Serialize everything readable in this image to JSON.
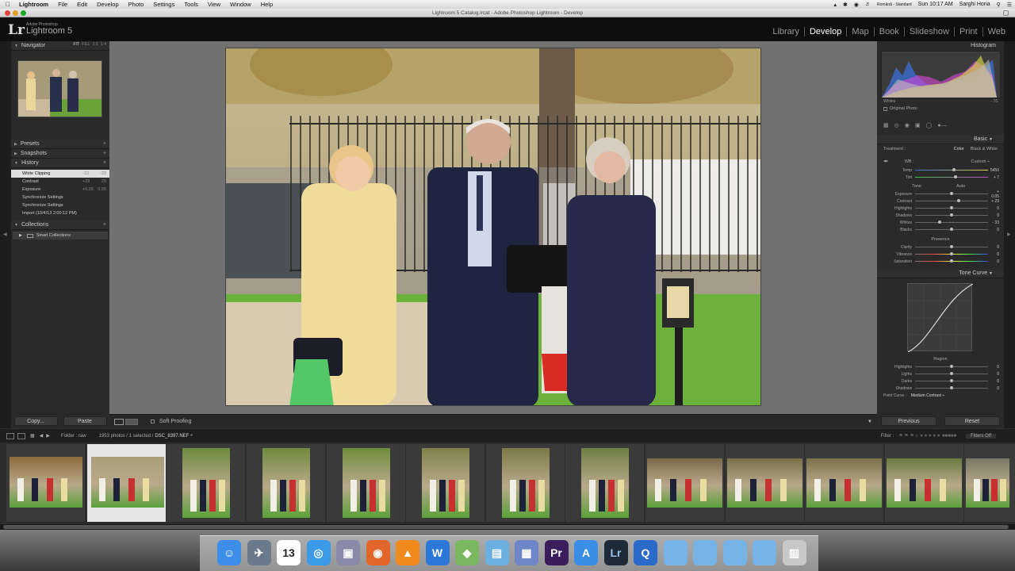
{
  "menubar": {
    "app": "Lightroom",
    "items": [
      "File",
      "Edit",
      "Develop",
      "Photo",
      "Settings",
      "Tools",
      "View",
      "Window",
      "Help"
    ],
    "status": {
      "lang": "Română - Standard",
      "time": "Sun 10:17 AM",
      "user": "Sarghi Horia"
    }
  },
  "window": {
    "title": "Lightroom 5 Catalog.lrcat - Adobe Photoshop Lightroom - Develop"
  },
  "header": {
    "brand": "Adobe Photoshop",
    "product": "Lightroom 5",
    "modules": [
      "Library",
      "Develop",
      "Map",
      "Book",
      "Slideshow",
      "Print",
      "Web"
    ],
    "active_module": "Develop"
  },
  "left": {
    "navigator": {
      "title": "Navigator",
      "views": [
        "FIT",
        "FILL",
        "1:1",
        "1:4"
      ]
    },
    "presets": "Presets",
    "snapshots": "Snapshots",
    "history": {
      "title": "History",
      "items": [
        {
          "label": "White Clipping",
          "a": "-33",
          "b": "-33"
        },
        {
          "label": "Contrast",
          "a": "+29",
          "b": "29"
        },
        {
          "label": "Exposure",
          "a": "+0.05",
          "b": "0.05"
        },
        {
          "label": "Synchronize Settings",
          "a": "",
          "b": ""
        },
        {
          "label": "Synchronize Settings",
          "a": "",
          "b": ""
        },
        {
          "label": "Import (10/4/13 2:00:12 PM)",
          "a": "",
          "b": ""
        }
      ]
    },
    "collections": {
      "title": "Collections",
      "item": "Smart Collections"
    },
    "copy": "Copy...",
    "paste": "Paste"
  },
  "toolbar": {
    "soft_proofing": "Soft Proofing"
  },
  "right": {
    "histogram": "Histogram",
    "hist_label": "Whites",
    "hist_value": "- 76",
    "original_photo": "Original Photo",
    "basic": "Basic",
    "treatment_label": "Treatment :",
    "treatment_color": "Color",
    "treatment_bw": "Black & White",
    "wb_label": "WB :",
    "wb_value": "Custom ÷",
    "tone": "Tone",
    "auto": "Auto",
    "presence": "Presence",
    "tone_curve": "Tone Curve",
    "region": "Region",
    "point_curve_label": "Point Curve :",
    "point_curve_value": "Medium Contrast ÷",
    "previous": "Previous",
    "reset": "Reset",
    "basic_sliders": [
      {
        "label": "Temp",
        "value": "5450",
        "pos": 0.53
      },
      {
        "label": "Tint",
        "value": "+ 7",
        "pos": 0.55
      }
    ],
    "tone_sliders": [
      {
        "label": "Exposure",
        "value": "+ 0.05",
        "pos": 0.5
      },
      {
        "label": "Contrast",
        "value": "+ 29",
        "pos": 0.6
      },
      {
        "label": "Highlights",
        "value": "0",
        "pos": 0.5
      },
      {
        "label": "Shadows",
        "value": "0",
        "pos": 0.5
      },
      {
        "label": "Whites",
        "value": "- 33",
        "pos": 0.34
      },
      {
        "label": "Blacks",
        "value": "0",
        "pos": 0.5
      }
    ],
    "presence_sliders": [
      {
        "label": "Clarity",
        "value": "0",
        "pos": 0.5
      },
      {
        "label": "Vibrance",
        "value": "0",
        "pos": 0.5
      },
      {
        "label": "Saturation",
        "value": "0",
        "pos": 0.5
      }
    ],
    "region_sliders": [
      {
        "label": "Highlights",
        "value": "0",
        "pos": 0.5
      },
      {
        "label": "Lights",
        "value": "0",
        "pos": 0.5
      },
      {
        "label": "Darks",
        "value": "0",
        "pos": 0.5
      },
      {
        "label": "Shadows",
        "value": "0",
        "pos": 0.5
      }
    ]
  },
  "filmstrip": {
    "folder": "Folder : raw",
    "count": "1953 photos / 1 selected /",
    "file": "DSC_8397.NEF ÷",
    "filter": "Filter :",
    "filter_value": "Filters Off"
  },
  "dock": {
    "items": [
      "finder",
      "launchpad",
      "calendar",
      "safari",
      "photos",
      "firefox",
      "vlc",
      "word",
      "maps",
      "preview",
      "iphoto",
      "premiere",
      "appstore",
      "lightroom",
      "quicktime",
      "folder",
      "folder",
      "folder",
      "folder",
      "trash"
    ],
    "calendar_date": "13"
  }
}
